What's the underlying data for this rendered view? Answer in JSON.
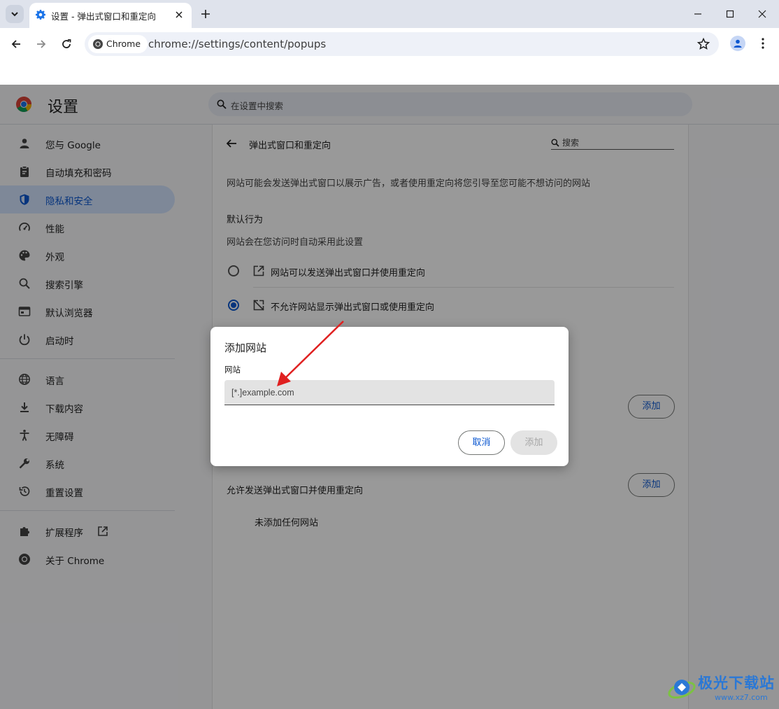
{
  "tab": {
    "title": "设置 - 弹出式窗口和重定向"
  },
  "omnibox": {
    "chip": "Chrome",
    "url": "chrome://settings/content/popups"
  },
  "header": {
    "title": "设置",
    "search_placeholder": "在设置中搜索"
  },
  "sidebar": {
    "items": [
      {
        "label": "您与 Google",
        "icon": "person-icon"
      },
      {
        "label": "自动填充和密码",
        "icon": "clipboard-icon"
      },
      {
        "label": "隐私和安全",
        "icon": "shield-icon",
        "active": true
      },
      {
        "label": "性能",
        "icon": "gauge-icon"
      },
      {
        "label": "外观",
        "icon": "palette-icon"
      },
      {
        "label": "搜索引擎",
        "icon": "search-icon"
      },
      {
        "label": "默认浏览器",
        "icon": "browser-icon"
      },
      {
        "label": "启动时",
        "icon": "power-icon"
      },
      {
        "label": "语言",
        "icon": "globe-icon"
      },
      {
        "label": "下载内容",
        "icon": "download-icon"
      },
      {
        "label": "无障碍",
        "icon": "accessibility-icon"
      },
      {
        "label": "系统",
        "icon": "wrench-icon"
      },
      {
        "label": "重置设置",
        "icon": "history-icon"
      },
      {
        "label": "扩展程序",
        "icon": "puzzle-icon"
      },
      {
        "label": "关于 Chrome",
        "icon": "chrome-icon"
      }
    ]
  },
  "content": {
    "title": "弹出式窗口和重定向",
    "search_label": "搜索",
    "description": "网站可能会发送弹出式窗口以展示广告，或者使用重定向将您引导至您可能不想访问的网站",
    "default_behavior": "默认行为",
    "default_sub": "网站会在您访问时自动采用此设置",
    "option_allow": "网站可以发送弹出式窗口并使用重定向",
    "option_block": "不允许网站显示弹出式窗口或使用重定向",
    "selected": "block",
    "add_label": "添加",
    "allowed_heading": "允许发送弹出式窗口并使用重定向",
    "no_sites": "未添加任何网站"
  },
  "dialog": {
    "title": "添加网站",
    "field_label": "网站",
    "placeholder": "[*.]example.com",
    "cancel": "取消",
    "add": "添加"
  },
  "watermark": {
    "name": "极光下载站",
    "url": "www.xz7.com"
  },
  "colors": {
    "accent": "#0b57d0",
    "active_nav_bg": "#d3e3fd",
    "arrow": "#e02020"
  }
}
